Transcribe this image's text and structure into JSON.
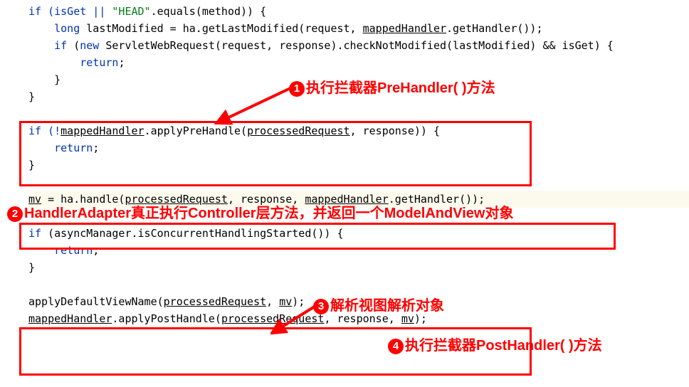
{
  "code": {
    "l1_pre": "if (isGet || ",
    "l1_str": "\"HEAD\"",
    "l1_post": ".equals(method)) {",
    "l2_a": "    ",
    "l2_long": "long",
    "l2_b": " lastModified = ha.getLastModified(request, ",
    "l2_mh": "mappedHandler",
    "l2_c": ".getHandler());",
    "l3_a": "    ",
    "l3_if": "if",
    "l3_b": " (",
    "l3_new": "new",
    "l3_c": " ServletWebRequest(request, response).checkNotModified(lastModified) && isGet) {",
    "l4_a": "        ",
    "l4_ret": "return",
    "l4_semi": ";",
    "l5": "    }",
    "l6": "}",
    "l7": "",
    "l8_a": "if (!",
    "l8_mh": "mappedHandler",
    "l8_b": ".applyPreHandle(",
    "l8_pr": "processedRequest",
    "l8_c": ", response)) {",
    "l9_a": "    ",
    "l9_ret": "return",
    "l9_semi": ";",
    "l10": "}",
    "l11": "",
    "l12_a": "mv",
    "l12_b": " = ha.handle(",
    "l12_pr": "processedRequest",
    "l12_c": ", response, ",
    "l12_mh": "mappedHandler",
    "l12_d": ".getHandler());",
    "l13": "",
    "l14_a": "if (asyncManager.isConcurrentHandlingStarted()) {",
    "l15_a": "    ",
    "l15_ret": "return",
    "l15_semi": ";",
    "l16": "}",
    "l17": "",
    "l18_a": "applyDefaultViewName(",
    "l18_pr": "processedRequest",
    "l18_b": ", ",
    "l18_mv": "mv",
    "l18_c": ");",
    "l19_mh": "mappedHandler",
    "l19_a": ".applyPostHandle(",
    "l19_pr": "processedRequest",
    "l19_b": ", response, ",
    "l19_mv": "mv",
    "l19_c": ");"
  },
  "annotations": {
    "a1": {
      "num": "1",
      "text": "执行拦截器PreHandler( )方法"
    },
    "a2": {
      "num": "2",
      "text": "HandlerAdapter真正执行Controller层方法，并返回一个ModelAndView对象"
    },
    "a3": {
      "num": "3",
      "text": "解析视图解析对象"
    },
    "a4": {
      "num": "4",
      "text": "执行拦截器PostHandler( )方法"
    }
  }
}
